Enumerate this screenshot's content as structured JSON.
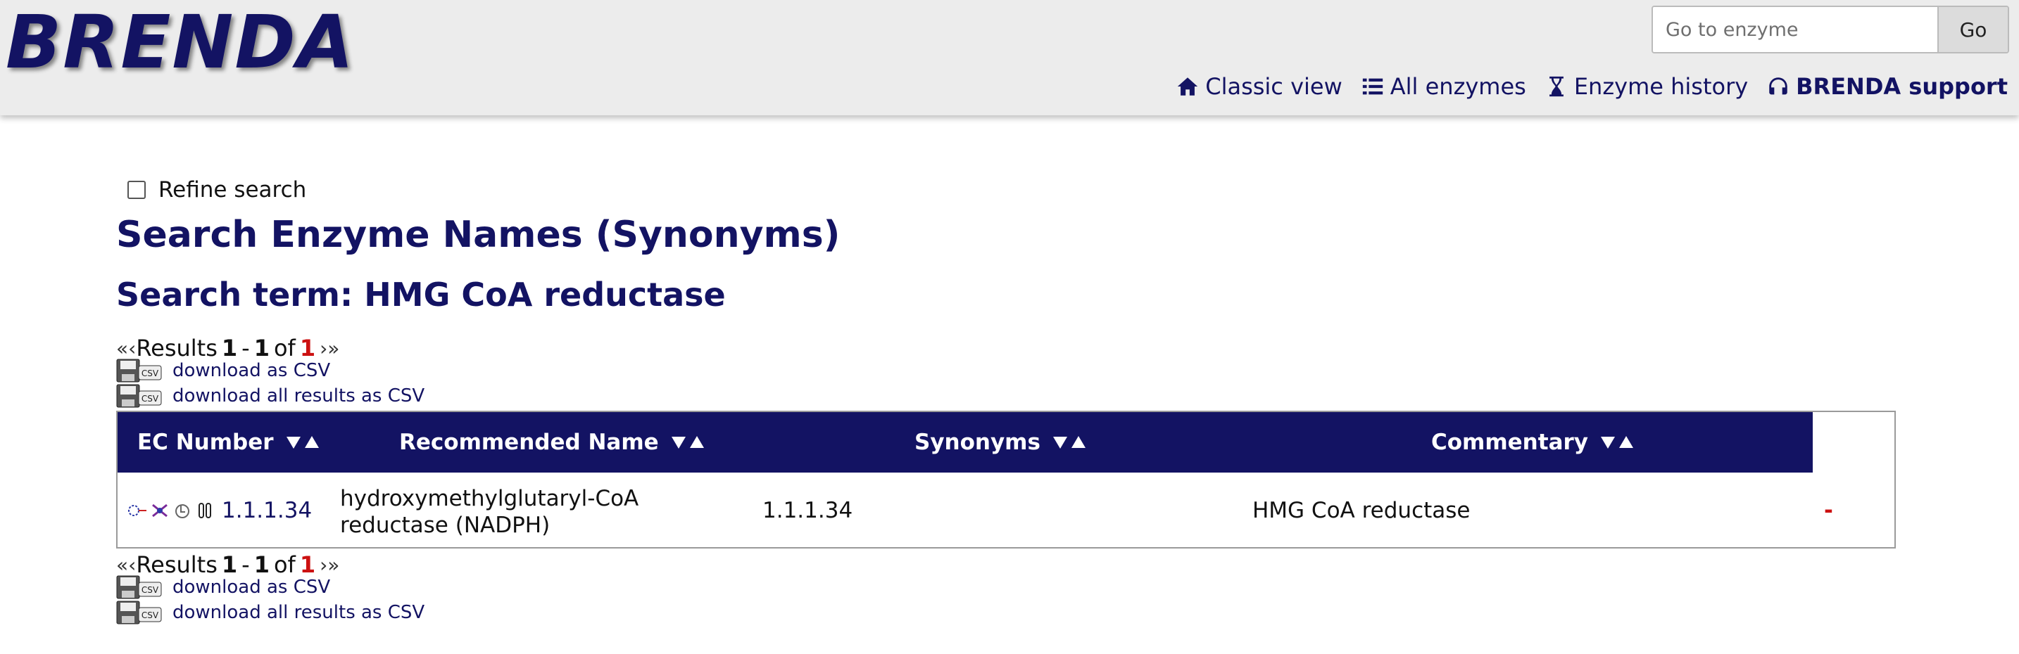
{
  "header": {
    "logo": "BRENDA",
    "search_placeholder": "Go to enzyme",
    "go_label": "Go",
    "nav": [
      {
        "label": "Classic view",
        "icon": "home-icon"
      },
      {
        "label": "All enzymes",
        "icon": "list-icon"
      },
      {
        "label": "Enzyme history",
        "icon": "hourglass-icon"
      },
      {
        "label": "BRENDA support",
        "icon": "headset-icon"
      }
    ]
  },
  "refine_label": "Refine search",
  "title": "Search Enzyme Names (Synonyms)",
  "search_term": "Search term: HMG CoA reductase",
  "pager": {
    "prefix": "Results",
    "start": "1",
    "separator": "-",
    "end": "1",
    "of": "of",
    "total": "1"
  },
  "downloads": {
    "csv": "download as CSV",
    "all_csv": "download all results as CSV"
  },
  "table": {
    "columns": [
      "EC Number",
      "Recommended Name",
      "Synonyms",
      "Commentary"
    ],
    "rows": [
      {
        "ec_number": "1.1.1.34",
        "recommended_name_line1": "hydroxymethylglutaryl-CoA",
        "recommended_name_line2": "reductase (NADPH)",
        "synonyms": "1.1.1.34",
        "commentary": "HMG CoA reductase",
        "extra": "-"
      }
    ]
  },
  "colors": {
    "brand": "#131363",
    "header_bg": "#ececec",
    "accent_red": "#cc1111"
  }
}
